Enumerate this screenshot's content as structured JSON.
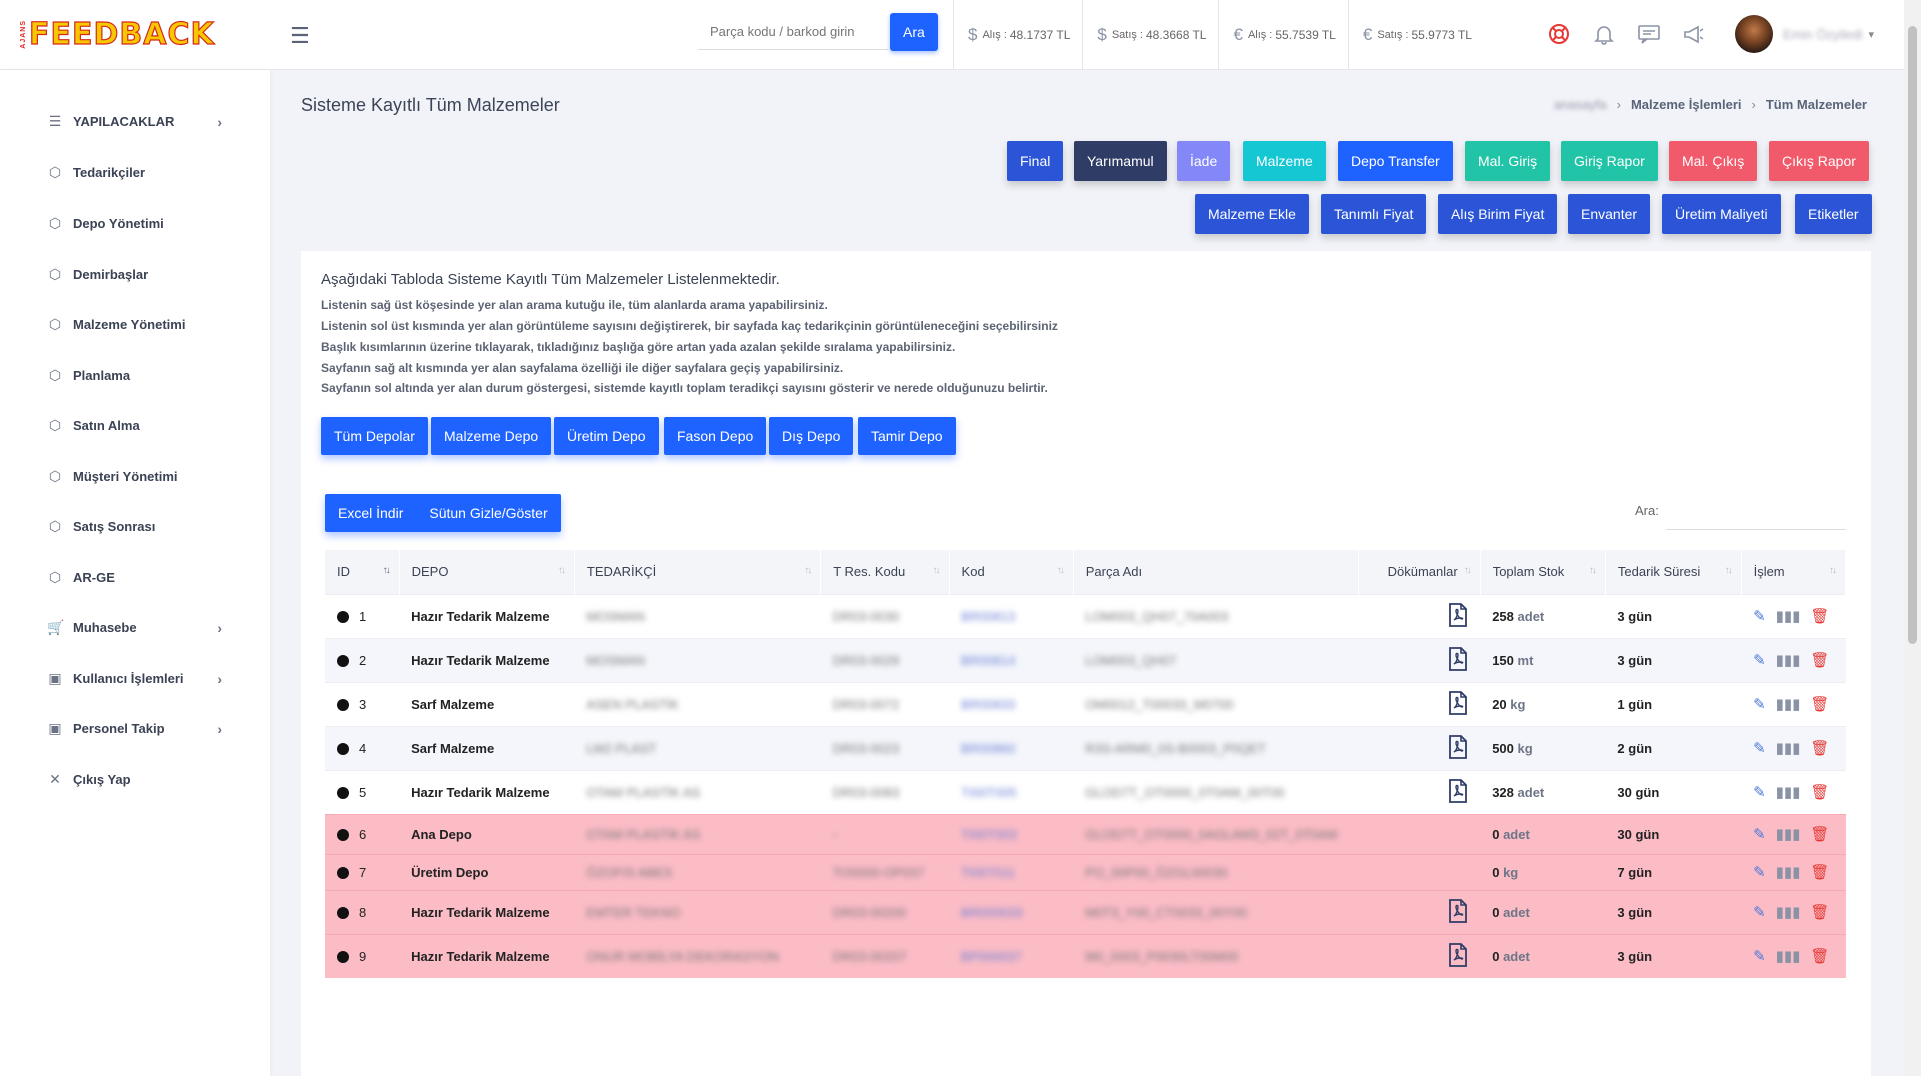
{
  "header": {
    "logo_text": "FEEDBACK",
    "logo_small": "AJANS",
    "search_placeholder": "Parça kodu / barkod girin",
    "search_button": "Ara",
    "rates": [
      {
        "symbol": "$",
        "label": "Alış",
        "value": "48.1737 TL"
      },
      {
        "symbol": "$",
        "label": "Satış",
        "value": "48.3668 TL"
      },
      {
        "symbol": "€",
        "label": "Alış",
        "value": "55.7539 TL"
      },
      {
        "symbol": "€",
        "label": "Satış",
        "value": "55.9773 TL"
      }
    ],
    "icons": [
      "lifebuoy-icon",
      "bell-icon",
      "message-icon",
      "megaphone-icon"
    ],
    "username": "Emin Özyiledi"
  },
  "sidebar": {
    "items": [
      {
        "label": "YAPILACAKLAR",
        "icon": "list-icon",
        "has_arrow": true
      },
      {
        "label": "Tedarikçiler",
        "icon": "box-icon",
        "has_arrow": false
      },
      {
        "label": "Depo Yönetimi",
        "icon": "box-icon",
        "has_arrow": false
      },
      {
        "label": "Demirbaşlar",
        "icon": "box-icon",
        "has_arrow": false
      },
      {
        "label": "Malzeme Yönetimi",
        "icon": "box-icon",
        "has_arrow": false
      },
      {
        "label": "Planlama",
        "icon": "box-icon",
        "has_arrow": false
      },
      {
        "label": "Satın Alma",
        "icon": "box-icon",
        "has_arrow": false
      },
      {
        "label": "Müşteri Yönetimi",
        "icon": "box-icon",
        "has_arrow": false
      },
      {
        "label": "Satış Sonrası",
        "icon": "box-icon",
        "has_arrow": false
      },
      {
        "label": "AR-GE",
        "icon": "box-icon",
        "has_arrow": false
      },
      {
        "label": "Muhasebe",
        "icon": "cart-icon",
        "has_arrow": true
      },
      {
        "label": "Kullanıcı İşlemleri",
        "icon": "chat-icon",
        "has_arrow": true
      },
      {
        "label": "Personel Takip",
        "icon": "chat-icon",
        "has_arrow": true
      },
      {
        "label": "Çıkış Yap",
        "icon": "close-icon",
        "has_arrow": false
      }
    ]
  },
  "page": {
    "title": "Sisteme Kayıtlı Tüm Malzemeler",
    "breadcrumb": [
      "anasayfa",
      "Malzeme İşlemleri",
      "Tüm Malzemeler"
    ]
  },
  "actions_row1": [
    {
      "label": "Final",
      "color": "#2b55d6"
    },
    {
      "label": "Yarımamul",
      "color": "#2f3d66"
    },
    {
      "label": "İade",
      "color": "#8387f7"
    },
    {
      "label": "Malzeme",
      "color": "#15c7d3"
    },
    {
      "label": "Depo Transfer",
      "color": "#1e62ff"
    },
    {
      "label": "Mal. Giriş",
      "color": "#22c4a7"
    },
    {
      "label": "Giriş Rapor",
      "color": "#22c4a7"
    },
    {
      "label": "Mal. Çıkış",
      "color": "#f05a6a"
    },
    {
      "label": "Çıkış Rapor",
      "color": "#f05a6a"
    }
  ],
  "actions_row2": [
    {
      "label": "Malzeme Ekle",
      "color": "#2b55d6"
    },
    {
      "label": "Tanımlı Fiyat",
      "color": "#2b55d6"
    },
    {
      "label": "Alış Birim Fiyat",
      "color": "#2b55d6"
    },
    {
      "label": "Envanter",
      "color": "#2b55d6"
    },
    {
      "label": "Üretim Maliyeti",
      "color": "#2b55d6"
    },
    {
      "label": "Etiketler",
      "color": "#2b55d6"
    }
  ],
  "intro": {
    "title": "Aşağıdaki Tabloda Sisteme Kayıtlı Tüm Malzemeler Listelenmektedir.",
    "lines": [
      "Listenin sağ üst köşesinde yer alan arama kutuğu ile, tüm alanlarda arama yapabilirsiniz.",
      "Listenin sol üst kısmında yer alan görüntüleme sayısını değiştirerek, bir sayfada kaç tedarikçinin görüntüleneceğini seçebilirsiniz",
      "Başlık kısımlarının üzerine tıklayarak, tıkladığınız başlığa göre artan yada azalan şekilde sıralama yapabilirsiniz.",
      "Sayfanın sağ alt kısmında yer alan sayfalama özelliği ile diğer sayfalara geçiş yapabilirsiniz.",
      "Sayfanın sol altında yer alan durum göstergesi, sistemde kayıtlı toplam teradikçi sayısını gösterir ve nerede olduğunuzu belirtir."
    ]
  },
  "depot_filters": [
    "Tüm Depolar",
    "Malzeme Depo",
    "Üretim Depo",
    "Fason Depo",
    "Dış Depo",
    "Tamir Depo"
  ],
  "toolbar": {
    "excel": "Excel İndir",
    "columns": "Sütun Gizle/Göster",
    "search_label": "Ara:"
  },
  "table": {
    "headers": [
      "ID",
      "DEPO",
      "TEDARİKÇİ",
      "T Res. Kodu",
      "Kod",
      "Parça Adı",
      "Dökümanlar",
      "Toplam Stok",
      "Tedarik Süresi",
      "İşlem"
    ],
    "rows": [
      {
        "id": "1",
        "depo": "Hazır Tedarik Malzeme",
        "tedarikci": "MOSMAN",
        "tres": "DR03-0030",
        "kod": "BR00813",
        "parca": "LOM003_QH07_70A003",
        "pdf": true,
        "stok": "258",
        "unit": "adet",
        "sure": "3 gün",
        "alert": false
      },
      {
        "id": "2",
        "depo": "Hazır Tedarik Malzeme",
        "tedarikci": "MOSMAN",
        "tres": "DR03-0029",
        "kod": "BR00814",
        "parca": "LOM003_QH07",
        "pdf": true,
        "stok": "150",
        "unit": "mt",
        "sure": "3 gün",
        "alert": false
      },
      {
        "id": "3",
        "depo": "Sarf Malzeme",
        "tedarikci": "ASEN PLASTİK",
        "tres": "DR03-0072",
        "kod": "BR00833",
        "parca": "OM0012_T00033_M0700",
        "pdf": true,
        "stok": "20",
        "unit": "kg",
        "sure": "1 gün",
        "alert": false
      },
      {
        "id": "4",
        "depo": "Sarf Malzeme",
        "tedarikci": "LM2 PLAST",
        "tres": "DR03-0023",
        "kod": "BR00860",
        "parca": "R3S-ARM0_0S-B0003_P0QET",
        "pdf": true,
        "stok": "500",
        "unit": "kg",
        "sure": "2 gün",
        "alert": false
      },
      {
        "id": "5",
        "depo": "Hazır Tedarik Malzeme",
        "tedarikci": "OTAM PLASTİK AS",
        "tres": "DR03-0083",
        "kod": "TI00T005",
        "parca": "GLOD7T_OT0000_0T0AM_00T00",
        "pdf": true,
        "stok": "328",
        "unit": "adet",
        "sure": "30 gün",
        "alert": false
      },
      {
        "id": "6",
        "depo": "Ana Depo",
        "tedarikci": "OTAM PLASTİK AS",
        "tres": "-",
        "kod": "TI00T003",
        "parca": "GLOD7T_OT0000_0AGLAM3_02T_0T0AM",
        "pdf": false,
        "stok": "0",
        "unit": "adet",
        "sure": "30 gün",
        "alert": true
      },
      {
        "id": "7",
        "depo": "Üretim Depo",
        "tedarikci": "ÖZOFIS ABES",
        "tres": "TO0000-OP037",
        "kod": "TI007011",
        "parca": "PO_00P00_ÖZGL00030",
        "pdf": false,
        "stok": "0",
        "unit": "kg",
        "sure": "7 gün",
        "alert": true
      },
      {
        "id": "8",
        "depo": "Hazır Tedarik Malzeme",
        "tedarikci": "EMTER TEKNO",
        "tres": "DR03-00200",
        "kod": "BR000033",
        "parca": "M0T3_Y00_CT0033_00Y00",
        "pdf": true,
        "stok": "0",
        "unit": "adet",
        "sure": "3 gün",
        "alert": true
      },
      {
        "id": "9",
        "depo": "Hazır Tedarik Malzeme",
        "tedarikci": "ONUR MOBİLYA DEKORASYON",
        "tres": "DR03-00207",
        "kod": "BP000037",
        "parca": "M0_0003_P0030LT00M00",
        "pdf": true,
        "stok": "0",
        "unit": "adet",
        "sure": "3 gün",
        "alert": true
      }
    ]
  }
}
